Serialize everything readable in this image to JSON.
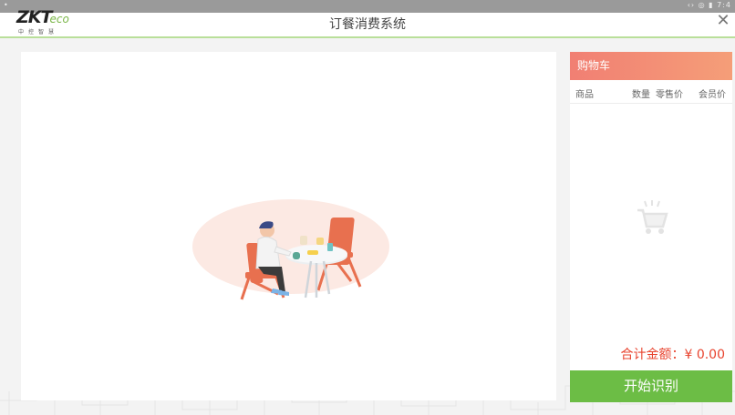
{
  "status_bar": {
    "left": "•",
    "right": "‹› ◎ ▮ 7:4"
  },
  "header": {
    "logo_main": "ZKT",
    "logo_eco": "eco",
    "logo_sub": "中控智慧",
    "title": "订餐消费系统",
    "close_label": "✕"
  },
  "cart": {
    "title": "购物车",
    "columns": {
      "goods": "商品",
      "qty": "数量",
      "price": "零售价",
      "member_price": "会员价"
    },
    "total_label": "合计金额：",
    "total_value": "¥ 0.00",
    "start_button": "开始识别"
  },
  "colors": {
    "accent_green": "#6cbd45",
    "cart_header_start": "#f17f73",
    "cart_header_end": "#f59e78",
    "total_red": "#e8432e"
  }
}
